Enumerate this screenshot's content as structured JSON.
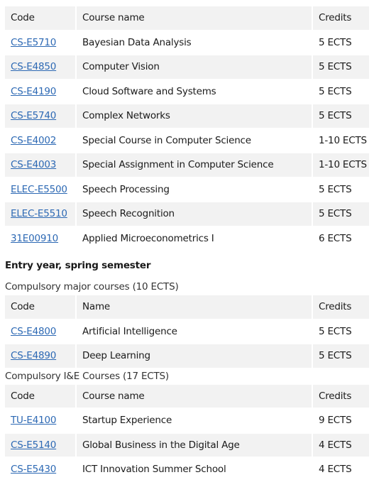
{
  "table1": {
    "headers": [
      "Code",
      "Course name",
      "Credits"
    ],
    "rows": [
      {
        "code": "CS-E5710",
        "name": "Bayesian Data Analysis",
        "credits": "5 ECTS"
      },
      {
        "code": "CS-E4850",
        "name": "Computer Vision",
        "credits": "5 ECTS"
      },
      {
        "code": "CS-E4190",
        "name": "Cloud Software and Systems",
        "credits": "5 ECTS"
      },
      {
        "code": "CS-E5740",
        "name": "Complex Networks",
        "credits": "5 ECTS"
      },
      {
        "code": "CS-E4002",
        "name": "Special Course in Computer Science",
        "credits": "1-10 ECTS"
      },
      {
        "code": "CS-E4003",
        "name": "Special Assignment in Computer Science",
        "credits": "1-10 ECTS"
      },
      {
        "code": "ELEC-E5500",
        "name": "Speech Processing",
        "credits": "5 ECTS"
      },
      {
        "code": "ELEC-E5510",
        "name": "Speech Recognition",
        "credits": "5 ECTS"
      },
      {
        "code": "31E00910",
        "name": "Applied Microeconometrics I",
        "credits": "6 ECTS"
      }
    ]
  },
  "section_heading": "Entry year, spring semester",
  "table2": {
    "caption": "Compulsory major courses (10 ECTS)",
    "headers": [
      "Code",
      "Name",
      "Credits"
    ],
    "rows": [
      {
        "code": "CS-E4800",
        "name": "Artificial Intelligence",
        "credits": "5 ECTS"
      },
      {
        "code": "CS-E4890",
        "name": "Deep Learning",
        "credits": "5 ECTS"
      }
    ]
  },
  "table3": {
    "caption": "Compulsory I&E Courses (17 ECTS)",
    "headers": [
      "Code",
      "Course name",
      "Credits"
    ],
    "rows": [
      {
        "code": "TU-E4100",
        "name": "Startup Experience",
        "credits": "9 ECTS"
      },
      {
        "code": "CS-E5140",
        "name": "Global Business in the Digital Age",
        "credits": "4 ECTS"
      },
      {
        "code": "CS-E5430",
        "name": "ICT Innovation Summer School",
        "credits": "4 ECTS"
      }
    ]
  }
}
